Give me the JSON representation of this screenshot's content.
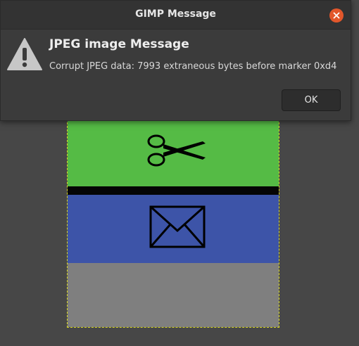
{
  "dialog": {
    "window_title": "GIMP Message",
    "heading": "JPEG image Message",
    "message": "Corrupt JPEG data: 7993 extraneous bytes before marker 0xd4",
    "ok_label": "OK",
    "icons": [
      "warning-icon",
      "close-icon"
    ],
    "accent_close_color": "#e2572b"
  },
  "canvas": {
    "image_bands_colors": [
      "#55bb45",
      "#050505",
      "#3d54a8",
      "#7f7f7f"
    ],
    "icons": [
      "scissors-icon",
      "envelope-icon"
    ]
  }
}
